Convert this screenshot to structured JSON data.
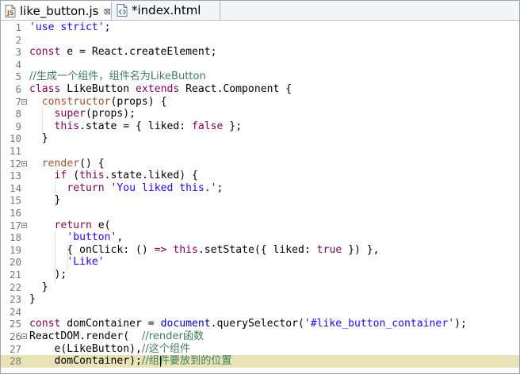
{
  "tabs": [
    {
      "label": "like_button.js",
      "icon": "js-file-icon",
      "close": "⊠",
      "active": true
    },
    {
      "label": "*index.html",
      "icon": "html-file-icon",
      "active": false
    }
  ],
  "colors": {
    "keyword": "#7f0055",
    "string": "#2a00ff",
    "comment": "#3f7f5f",
    "current_line": "#e8e2b7"
  },
  "lines": [
    {
      "n": "1",
      "tokens": [
        {
          "t": "'use strict'",
          "c": "s"
        },
        {
          "t": ";",
          "c": ""
        }
      ]
    },
    {
      "n": "2",
      "tokens": []
    },
    {
      "n": "3",
      "tokens": [
        {
          "t": "const",
          "c": "k"
        },
        {
          "t": " e = React.createElement;",
          "c": ""
        }
      ]
    },
    {
      "n": "4",
      "tokens": []
    },
    {
      "n": "5",
      "tokens": [
        {
          "t": "//生成一个组件，组件名为LikeButton",
          "c": "m"
        }
      ]
    },
    {
      "n": "6",
      "tokens": [
        {
          "t": "class",
          "c": "k"
        },
        {
          "t": " LikeButton ",
          "c": ""
        },
        {
          "t": "extends",
          "c": "k"
        },
        {
          "t": " React.Component {",
          "c": ""
        }
      ]
    },
    {
      "n": "7",
      "fold": true,
      "tokens": [
        {
          "t": "  ",
          "c": ""
        },
        {
          "t": "constructor",
          "c": "f"
        },
        {
          "t": "(props) {",
          "c": ""
        }
      ]
    },
    {
      "n": "8",
      "tokens": [
        {
          "t": "    ",
          "c": ""
        },
        {
          "t": "super",
          "c": "k"
        },
        {
          "t": "(props);",
          "c": ""
        }
      ]
    },
    {
      "n": "9",
      "tokens": [
        {
          "t": "    ",
          "c": ""
        },
        {
          "t": "this",
          "c": "k"
        },
        {
          "t": ".state = { liked: ",
          "c": ""
        },
        {
          "t": "false",
          "c": "k"
        },
        {
          "t": " };",
          "c": ""
        }
      ]
    },
    {
      "n": "10",
      "tokens": [
        {
          "t": "  }",
          "c": ""
        }
      ]
    },
    {
      "n": "11",
      "tokens": []
    },
    {
      "n": "12",
      "fold": true,
      "tokens": [
        {
          "t": "  ",
          "c": ""
        },
        {
          "t": "render",
          "c": "f"
        },
        {
          "t": "() {",
          "c": ""
        }
      ]
    },
    {
      "n": "13",
      "tokens": [
        {
          "t": "    ",
          "c": ""
        },
        {
          "t": "if",
          "c": "k"
        },
        {
          "t": " (",
          "c": ""
        },
        {
          "t": "this",
          "c": "k"
        },
        {
          "t": ".state.liked) {",
          "c": ""
        }
      ]
    },
    {
      "n": "14",
      "tokens": [
        {
          "t": "      ",
          "c": ""
        },
        {
          "t": "return",
          "c": "k"
        },
        {
          "t": " ",
          "c": ""
        },
        {
          "t": "'You liked this.'",
          "c": "s"
        },
        {
          "t": ";",
          "c": ""
        }
      ]
    },
    {
      "n": "15",
      "tokens": [
        {
          "t": "    }",
          "c": ""
        }
      ]
    },
    {
      "n": "16",
      "tokens": []
    },
    {
      "n": "17",
      "fold": true,
      "tokens": [
        {
          "t": "    ",
          "c": ""
        },
        {
          "t": "return",
          "c": "k"
        },
        {
          "t": " e(",
          "c": ""
        }
      ]
    },
    {
      "n": "18",
      "tokens": [
        {
          "t": "      ",
          "c": ""
        },
        {
          "t": "'button'",
          "c": "s"
        },
        {
          "t": ",",
          "c": ""
        }
      ]
    },
    {
      "n": "19",
      "tokens": [
        {
          "t": "      { onClick: () ",
          "c": ""
        },
        {
          "t": "=>",
          "c": "k"
        },
        {
          "t": " ",
          "c": ""
        },
        {
          "t": "this",
          "c": "k"
        },
        {
          "t": ".setState({ liked: ",
          "c": ""
        },
        {
          "t": "true",
          "c": "k"
        },
        {
          "t": " }) },",
          "c": ""
        }
      ]
    },
    {
      "n": "20",
      "tokens": [
        {
          "t": "      ",
          "c": ""
        },
        {
          "t": "'Like'",
          "c": "s"
        }
      ]
    },
    {
      "n": "21",
      "tokens": [
        {
          "t": "    );",
          "c": ""
        }
      ]
    },
    {
      "n": "22",
      "tokens": [
        {
          "t": "  }",
          "c": ""
        }
      ]
    },
    {
      "n": "23",
      "tokens": [
        {
          "t": "}",
          "c": ""
        }
      ]
    },
    {
      "n": "24",
      "tokens": []
    },
    {
      "n": "25",
      "tokens": [
        {
          "t": "const",
          "c": "k"
        },
        {
          "t": " domContainer = ",
          "c": ""
        },
        {
          "t": "document",
          "c": "g"
        },
        {
          "t": ".querySelector(",
          "c": ""
        },
        {
          "t": "'#like_button_container'",
          "c": "s"
        },
        {
          "t": ");",
          "c": ""
        }
      ]
    },
    {
      "n": "26",
      "fold": true,
      "tokens": [
        {
          "t": "ReactDOM.render(  ",
          "c": ""
        },
        {
          "t": "//render函数",
          "c": "m"
        }
      ]
    },
    {
      "n": "27",
      "tokens": [
        {
          "t": "    e(LikeButton),",
          "c": ""
        },
        {
          "t": "//这个组件",
          "c": "m"
        }
      ]
    },
    {
      "n": "28",
      "highlight": true,
      "tokens": [
        {
          "t": "    domContainer);",
          "c": ""
        },
        {
          "t": "//组件要放到的位置",
          "c": "m"
        }
      ]
    }
  ]
}
